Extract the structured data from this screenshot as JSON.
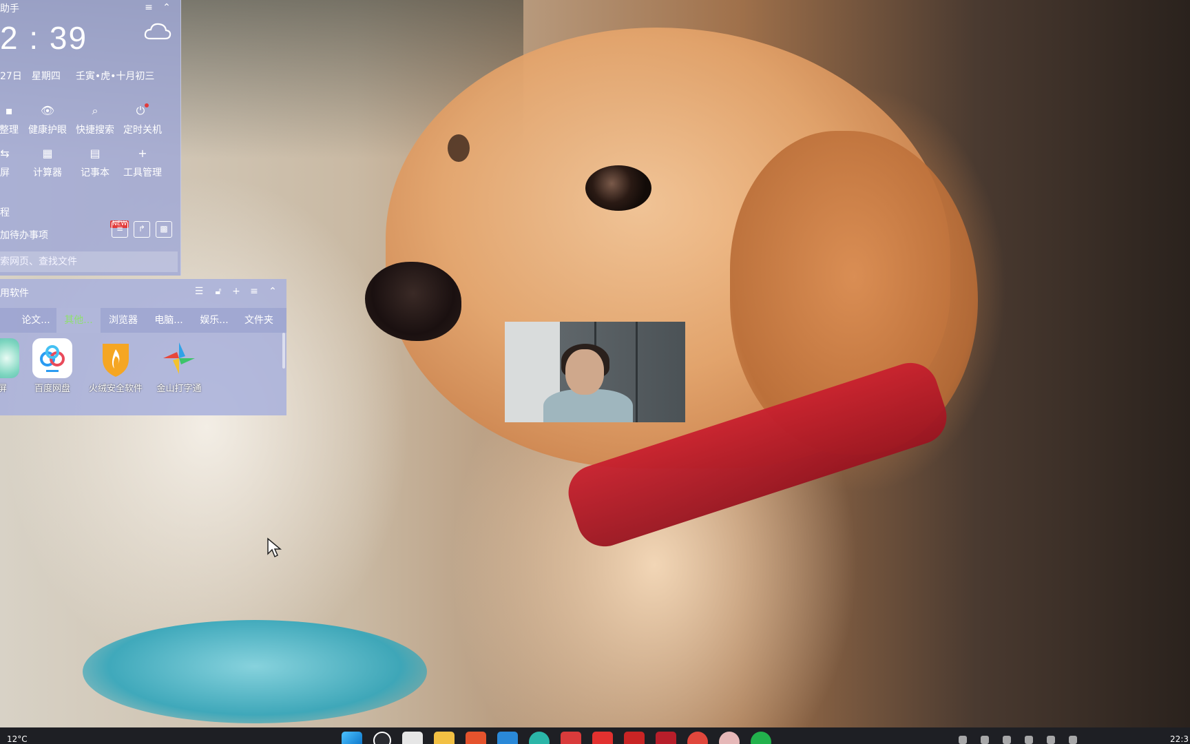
{
  "assistant": {
    "title": "助手",
    "clock": "2 : 39",
    "date": "27日",
    "weekday": "星期四",
    "lunar": "壬寅•虎•十月初三",
    "tools_row1": [
      "整理",
      "健康护眼",
      "快捷搜索",
      "定时关机"
    ],
    "tools_row2": [
      "屏",
      "计算器",
      "记事本",
      "工具管理"
    ],
    "section_label": "程",
    "todo_placeholder": "加待办事项",
    "new_badge": "NEW",
    "search_placeholder": "索网页、查找文件"
  },
  "software_box": {
    "title": "用软件",
    "tabs": [
      "",
      "论文...",
      "其他...",
      "浏览器",
      "电脑...",
      "娱乐...",
      "文件夹"
    ],
    "active_tab_index": 2,
    "apps": [
      {
        "name": "录屏",
        "icon": "recorder-icon"
      },
      {
        "name": "百度网盘",
        "icon": "baidu-netdisk-icon"
      },
      {
        "name": "火绒安全软件",
        "icon": "huorong-security-icon"
      },
      {
        "name": "金山打字通",
        "icon": "kingsoft-typing-icon"
      }
    ]
  },
  "taskbar": {
    "temperature": "12°C",
    "time": "22:3",
    "pinned_apps": [
      "start-icon",
      "search-icon",
      "task-view-icon",
      "file-explorer-icon",
      "office-icon",
      "vscode-icon",
      "edge-icon",
      "app-icon",
      "app-icon",
      "app-icon",
      "app-icon",
      "app-icon",
      "app-icon",
      "wechat-icon"
    ]
  },
  "colors": {
    "widget_bg": "#a0a8d7",
    "active_tab_text": "#8fe06f",
    "taskbar_bg": "#1e1f24",
    "collar_red": "#c8202e"
  }
}
